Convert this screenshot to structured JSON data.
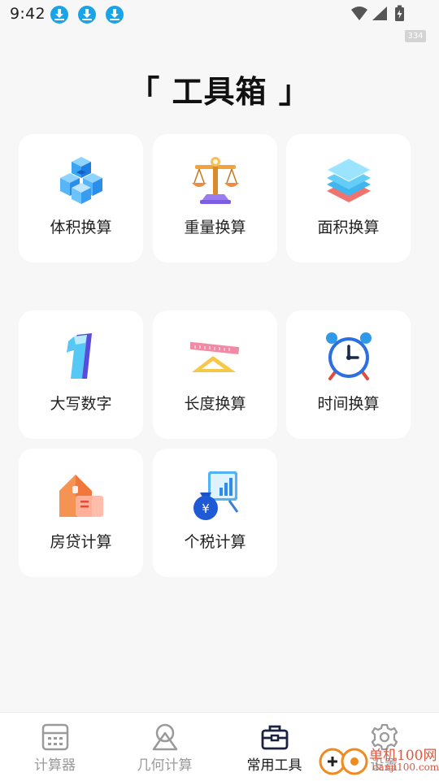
{
  "status_bar": {
    "time": "9:42",
    "badge": "334",
    "notification_icons": [
      "download-icon",
      "download-icon",
      "download-icon"
    ],
    "system_icons": [
      "wifi-icon",
      "cellular-signal-icon",
      "battery-charging-icon"
    ]
  },
  "page": {
    "title": "「 工具箱 」"
  },
  "tools": [
    {
      "label": "体积换算",
      "icon": "cube-stack-icon"
    },
    {
      "label": "重量换算",
      "icon": "balance-scale-icon"
    },
    {
      "label": "面积换算",
      "icon": "layers-icon"
    },
    {
      "label": "大写数字",
      "icon": "number-one-icon"
    },
    {
      "label": "长度换算",
      "icon": "ruler-triangle-icon"
    },
    {
      "label": "时间换算",
      "icon": "alarm-clock-icon"
    },
    {
      "label": "房贷计算",
      "icon": "house-calc-icon"
    },
    {
      "label": "个税计算",
      "icon": "money-bag-chart-icon"
    }
  ],
  "bottom_nav": {
    "items": [
      {
        "label": "计算器",
        "icon": "calculator-icon",
        "active": false
      },
      {
        "label": "几何计算",
        "icon": "geometry-icon",
        "active": false
      },
      {
        "label": "常用工具",
        "icon": "toolbox-icon",
        "active": true
      },
      {
        "label": "设置",
        "icon": "gear-icon",
        "active": false
      }
    ]
  },
  "watermark": {
    "text": "单机100网",
    "sub": "danji100.com"
  },
  "colors": {
    "background": "#f7f7f7",
    "card": "#ffffff",
    "active_nav": "#1b1b1b",
    "inactive_nav": "#9a9a9a",
    "download_badge": "#1aa3e8"
  }
}
